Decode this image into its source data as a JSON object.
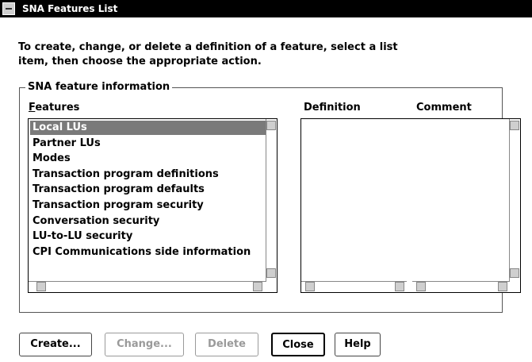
{
  "window": {
    "title": "SNA Features List"
  },
  "instructions": "To create, change, or delete a definition of a feature, select a list\nitem, then choose the appropriate action.",
  "group": {
    "label": "SNA feature information"
  },
  "features": {
    "label": "Features",
    "mnemonic": "F",
    "label_rest": "eatures",
    "selected_index": 0,
    "items": [
      "Local LUs",
      "Partner LUs",
      "Modes",
      "Transaction program definitions",
      "Transaction program defaults",
      "Transaction program security",
      "Conversation security",
      "LU-to-LU security",
      "CPI Communications side information"
    ]
  },
  "definition": {
    "label": "Definition",
    "items": []
  },
  "comment": {
    "label": "Comment",
    "items": []
  },
  "buttons": {
    "create": {
      "label": "Create...",
      "enabled": true
    },
    "change": {
      "label": "Change...",
      "enabled": false
    },
    "delete": {
      "label": "Delete",
      "enabled": false
    },
    "close": {
      "label": "Close",
      "enabled": true,
      "default": true
    },
    "help": {
      "label": "Help",
      "enabled": true
    }
  }
}
